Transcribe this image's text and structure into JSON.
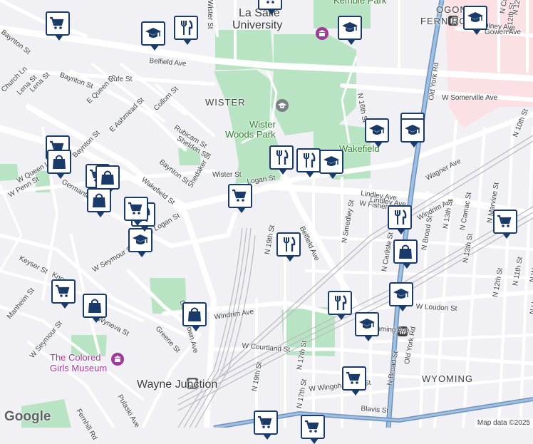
{
  "attribution": "Map data ©2025",
  "logo": "Google",
  "colors": {
    "road": "#ffffff",
    "highway": "#7fa6cc",
    "park": "#b8e4c3",
    "hospital": "#fbe1e4",
    "water": "#aadaff",
    "marker_border": "#1a3b6a",
    "marker_icon": "#1a3b6a"
  },
  "area_labels": [
    {
      "text": "WISTER"
    },
    {
      "text": "WYOMING"
    },
    {
      "text": "OGONTZ-"
    },
    {
      "text": "FERN ROCK"
    }
  ],
  "big_labels": [
    {
      "text": "La Salle"
    },
    {
      "text": "University"
    },
    {
      "text": "Wayne Junction"
    }
  ],
  "park_labels": [
    {
      "text": "Wister"
    },
    {
      "text": "Woods Park"
    },
    {
      "text": "Wakefield"
    },
    {
      "text": "Kemble Park"
    }
  ],
  "poi_labels": [
    {
      "text": "The Colored"
    },
    {
      "text": "Girls Museum"
    }
  ],
  "street_labels": [
    {
      "text": "Baynton St"
    },
    {
      "text": "Belfield Ave"
    },
    {
      "text": "Rufe St"
    },
    {
      "text": "Baynton St"
    },
    {
      "text": "E Queen Ln"
    },
    {
      "text": "E Ashmead St"
    },
    {
      "text": "Collom St"
    },
    {
      "text": "Church Ln"
    },
    {
      "text": "Lena St"
    },
    {
      "text": "Rubicam St"
    },
    {
      "text": "Sheldon St"
    },
    {
      "text": "Baynton St"
    },
    {
      "text": "Shedaker St"
    },
    {
      "text": "Wakefield St"
    },
    {
      "text": "W Penn St"
    },
    {
      "text": "W Queen Ln"
    },
    {
      "text": "Germantown"
    },
    {
      "text": "E Logan St"
    },
    {
      "text": "W Seymour St"
    },
    {
      "text": "Knox St"
    },
    {
      "text": "Keyser St"
    },
    {
      "text": "Manheim St"
    },
    {
      "text": "W Seymour St"
    },
    {
      "text": "Wyneva St"
    },
    {
      "text": "Greene St"
    },
    {
      "text": "Germantown Ave"
    },
    {
      "text": "Pulaski Ave"
    },
    {
      "text": "Fernhill Rd"
    },
    {
      "text": "Wister St"
    },
    {
      "text": "Logan St"
    },
    {
      "text": "Lindley Ave"
    },
    {
      "text": "W Fisher Ave"
    },
    {
      "text": "Wagner Ave"
    },
    {
      "text": "Windrim Ave"
    },
    {
      "text": "Windrim Ave"
    },
    {
      "text": "N 19th St"
    },
    {
      "text": "N 17th St"
    },
    {
      "text": "N Smedley St"
    },
    {
      "text": "Belfield Ave"
    },
    {
      "text": "W Somerville Ave"
    },
    {
      "text": "N 16th St"
    },
    {
      "text": "N Broad St"
    },
    {
      "text": "Old York Rd"
    },
    {
      "text": "N 13th St"
    },
    {
      "text": "N 10th St"
    },
    {
      "text": "N 12th St"
    },
    {
      "text": "N Marvine St"
    },
    {
      "text": "N Camac St"
    },
    {
      "text": "N 13th St"
    },
    {
      "text": "N 12th St"
    },
    {
      "text": "N 11th St"
    },
    {
      "text": "N Warnock St"
    },
    {
      "text": "N Hutchinson St"
    },
    {
      "text": "W Courtland St"
    },
    {
      "text": "N 19th St"
    },
    {
      "text": "N 17th St"
    },
    {
      "text": "W Wingohocking St"
    },
    {
      "text": "Blavis St"
    },
    {
      "text": "W Wyoming Ave"
    },
    {
      "text": "W Loudon St"
    },
    {
      "text": "N Carlisle St"
    },
    {
      "text": "Old York Rd"
    },
    {
      "text": "N Broad St"
    },
    {
      "text": "N 12th St"
    },
    {
      "text": "W Olney Ave"
    },
    {
      "text": "N Camac St"
    },
    {
      "text": "Gowen Ave"
    },
    {
      "text": "Lena St"
    },
    {
      "text": "Baynton St"
    },
    {
      "text": "Wister St"
    },
    {
      "text": "Lindley Ave"
    }
  ],
  "markers": [
    {
      "type": "shopping-cart"
    },
    {
      "type": "graduation-cap"
    },
    {
      "type": "fork-knife"
    },
    {
      "type": "graduation-cap"
    },
    {
      "type": "graduation-cap"
    },
    {
      "type": "shopping-cart"
    },
    {
      "type": "graduation-cap"
    },
    {
      "type": "graduation-cap"
    },
    {
      "type": "graduation-cap"
    },
    {
      "type": "fork-knife"
    },
    {
      "type": "fork-knife"
    },
    {
      "type": "graduation-cap"
    },
    {
      "type": "shopping-bag"
    },
    {
      "type": "shopping-bag"
    },
    {
      "type": "shopping-cart"
    },
    {
      "type": "shopping-bag"
    },
    {
      "type": "shopping-cart"
    },
    {
      "type": "shopping-cart"
    },
    {
      "type": "fork-knife"
    },
    {
      "type": "graduation-cap"
    },
    {
      "type": "shopping-cart"
    },
    {
      "type": "fork-knife"
    },
    {
      "type": "fork-knife"
    },
    {
      "type": "shopping-cart"
    },
    {
      "type": "shopping-bag"
    },
    {
      "type": "graduation-cap"
    },
    {
      "type": "shopping-cart"
    },
    {
      "type": "shopping-bag"
    },
    {
      "type": "shopping-bag"
    },
    {
      "type": "fork-knife"
    },
    {
      "type": "graduation-cap"
    },
    {
      "type": "shopping-cart"
    },
    {
      "type": "shopping-cart"
    },
    {
      "type": "shopping-cart"
    }
  ]
}
